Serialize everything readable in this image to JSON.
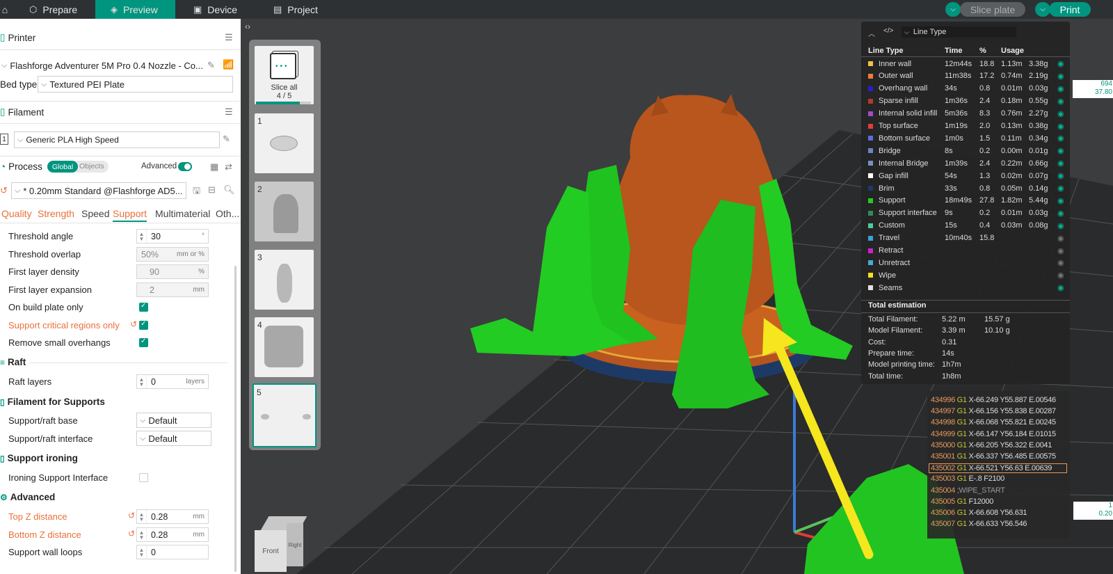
{
  "topbar": {
    "tabs": [
      {
        "label": "Prepare"
      },
      {
        "label": "Preview"
      },
      {
        "label": "Device"
      },
      {
        "label": "Project"
      }
    ],
    "slice_plate": "Slice plate",
    "print": "Print"
  },
  "sidebar": {
    "printer_title": "Printer",
    "printer_name": "Flashforge Adventurer 5M Pro 0.4 Nozzle - Co...",
    "bed_type_label": "Bed type",
    "bed_type_value": "Textured PEI Plate",
    "filament_title": "Filament",
    "filament_index": "1",
    "filament_name": "Generic PLA High Speed",
    "process_title": "Process",
    "global_label": "Global",
    "objects_label": "Objects",
    "advanced_label": "Advanced",
    "preset": "* 0.20mm Standard @Flashforge AD5...",
    "subtabs": [
      "Quality",
      "Strength",
      "Speed",
      "Support",
      "Multimaterial",
      "Oth..."
    ],
    "settings": {
      "threshold_angle": {
        "label": "Threshold angle",
        "value": "30",
        "unit": "°"
      },
      "threshold_overlap": {
        "label": "Threshold overlap",
        "value": "50%",
        "unit": "mm or %"
      },
      "first_layer_density": {
        "label": "First layer density",
        "value": "90",
        "unit": "%"
      },
      "first_layer_expansion": {
        "label": "First layer expansion",
        "value": "2",
        "unit": "mm"
      },
      "on_build_plate_only": {
        "label": "On build plate only"
      },
      "support_critical": {
        "label": "Support critical regions only"
      },
      "remove_small": {
        "label": "Remove small overhangs"
      },
      "raft_group": "Raft",
      "raft_layers": {
        "label": "Raft layers",
        "value": "0",
        "unit": "layers"
      },
      "filament_supports_group": "Filament for Supports",
      "support_raft_base": {
        "label": "Support/raft base",
        "value": "Default"
      },
      "support_raft_interface": {
        "label": "Support/raft interface",
        "value": "Default"
      },
      "support_ironing_group": "Support ironing",
      "ironing_support_interface": {
        "label": "Ironing Support Interface"
      },
      "advanced_group": "Advanced",
      "top_z": {
        "label": "Top Z distance",
        "value": "0.28",
        "unit": "mm"
      },
      "bottom_z": {
        "label": "Bottom Z distance",
        "value": "0.28",
        "unit": "mm"
      },
      "support_wall_loops": {
        "label": "Support wall loops",
        "value": "0"
      }
    }
  },
  "plates": {
    "slice_all": "Slice all",
    "slice_all_count": "4 / 5",
    "slice_progress": 0.8,
    "numbers": [
      "1",
      "2",
      "3",
      "4",
      "5"
    ]
  },
  "legend": {
    "dropdown": "Line Type",
    "headers": [
      "Line Type",
      "Time",
      "%",
      "Usage"
    ],
    "rows": [
      {
        "name": "Inner wall",
        "color": "#f2c24a",
        "time": "12m44s",
        "pct": "18.8",
        "len": "1.13m",
        "wt": "3.38g",
        "visible": true
      },
      {
        "name": "Outer wall",
        "color": "#f07c3a",
        "time": "11m38s",
        "pct": "17.2",
        "len": "0.74m",
        "wt": "2.19g",
        "visible": true
      },
      {
        "name": "Overhang wall",
        "color": "#2222cc",
        "time": "34s",
        "pct": "0.8",
        "len": "0.01m",
        "wt": "0.03g",
        "visible": true
      },
      {
        "name": "Sparse infill",
        "color": "#b03a2e",
        "time": "1m36s",
        "pct": "2.4",
        "len": "0.18m",
        "wt": "0.55g",
        "visible": true
      },
      {
        "name": "Internal solid infill",
        "color": "#9b4fc9",
        "time": "5m36s",
        "pct": "8.3",
        "len": "0.76m",
        "wt": "2.27g",
        "visible": true
      },
      {
        "name": "Top surface",
        "color": "#e03c3c",
        "time": "1m19s",
        "pct": "2.0",
        "len": "0.13m",
        "wt": "0.38g",
        "visible": true
      },
      {
        "name": "Bottom surface",
        "color": "#5b6cd8",
        "time": "1m0s",
        "pct": "1.5",
        "len": "0.11m",
        "wt": "0.34g",
        "visible": true
      },
      {
        "name": "Bridge",
        "color": "#6b85c4",
        "time": "8s",
        "pct": "0.2",
        "len": "0.00m",
        "wt": "0.01g",
        "visible": true
      },
      {
        "name": "Internal Bridge",
        "color": "#7a8fc7",
        "time": "1m39s",
        "pct": "2.4",
        "len": "0.22m",
        "wt": "0.66g",
        "visible": true
      },
      {
        "name": "Gap infill",
        "color": "#ffffff",
        "time": "54s",
        "pct": "1.3",
        "len": "0.02m",
        "wt": "0.07g",
        "visible": true
      },
      {
        "name": "Brim",
        "color": "#1e3a6b",
        "time": "33s",
        "pct": "0.8",
        "len": "0.05m",
        "wt": "0.14g",
        "visible": true
      },
      {
        "name": "Support",
        "color": "#22cc22",
        "time": "18m49s",
        "pct": "27.8",
        "len": "1.82m",
        "wt": "5.44g",
        "visible": true
      },
      {
        "name": "Support interface",
        "color": "#2e8b57",
        "time": "9s",
        "pct": "0.2",
        "len": "0.01m",
        "wt": "0.03g",
        "visible": true
      },
      {
        "name": "Custom",
        "color": "#4ec9a0",
        "time": "15s",
        "pct": "0.4",
        "len": "0.03m",
        "wt": "0.08g",
        "visible": true
      },
      {
        "name": "Travel",
        "color": "#3aa0d8",
        "time": "10m40s",
        "pct": "15.8",
        "len": "",
        "wt": "",
        "visible": false
      },
      {
        "name": "Retract",
        "color": "#cc22cc",
        "time": "",
        "pct": "",
        "len": "",
        "wt": "",
        "visible": false
      },
      {
        "name": "Unretract",
        "color": "#4aa8d8",
        "time": "",
        "pct": "",
        "len": "",
        "wt": "",
        "visible": false
      },
      {
        "name": "Wipe",
        "color": "#f0e020",
        "time": "",
        "pct": "",
        "len": "",
        "wt": "",
        "visible": false
      },
      {
        "name": "Seams",
        "color": "#e0e0e0",
        "time": "",
        "pct": "",
        "len": "",
        "wt": "",
        "visible": true
      }
    ],
    "estimation_title": "Total estimation",
    "estimation": [
      {
        "label": "Total Filament:",
        "v1": "5.22 m",
        "v2": "15.57 g"
      },
      {
        "label": "Model Filament:",
        "v1": "3.39 m",
        "v2": "10.10 g"
      },
      {
        "label": "Cost:",
        "v1": "0.31",
        "v2": ""
      },
      {
        "label": "Prepare time:",
        "v1": "14s",
        "v2": ""
      },
      {
        "label": "Model printing time:",
        "v1": "1h7m",
        "v2": ""
      },
      {
        "label": "Total time:",
        "v1": "1h8m",
        "v2": ""
      }
    ]
  },
  "gcode": [
    {
      "line": "434996",
      "cmd": "G1",
      "args": "X-66.249 Y55.887 E.00546"
    },
    {
      "line": "434997",
      "cmd": "G1",
      "args": "X-66.156 Y55.838 E.00287"
    },
    {
      "line": "434998",
      "cmd": "G1",
      "args": "X-66.068 Y55.821 E.00245"
    },
    {
      "line": "434999",
      "cmd": "G1",
      "args": "X-66.147 Y56.184 E.01015"
    },
    {
      "line": "435000",
      "cmd": "G1",
      "args": "X-66.205 Y56.322 E.0041"
    },
    {
      "line": "435001",
      "cmd": "G1",
      "args": "X-66.337 Y56.485 E.00575"
    },
    {
      "line": "435002",
      "cmd": "G1",
      "args": "X-66.521 Y56.63 E.00639"
    },
    {
      "line": "435003",
      "cmd": "G1",
      "args": "E-.8 F2100"
    },
    {
      "line": "435004",
      "cmd": "",
      "args": ";WIPE_START"
    },
    {
      "line": "435005",
      "cmd": "G1",
      "args": "F12000"
    },
    {
      "line": "435006",
      "cmd": "G1",
      "args": "X-66.608 Y56.631"
    },
    {
      "line": "435007",
      "cmd": "G1",
      "args": "X-66.633 Y56.546"
    }
  ],
  "edge_labels": {
    "top_a": "694",
    "top_b": "37.80",
    "bottom_a": "1",
    "bottom_b": "0.20"
  },
  "cube": {
    "front": "Front",
    "right": "Right"
  },
  "colors": {
    "accent": "#00957f",
    "orange": "#e8703a"
  }
}
